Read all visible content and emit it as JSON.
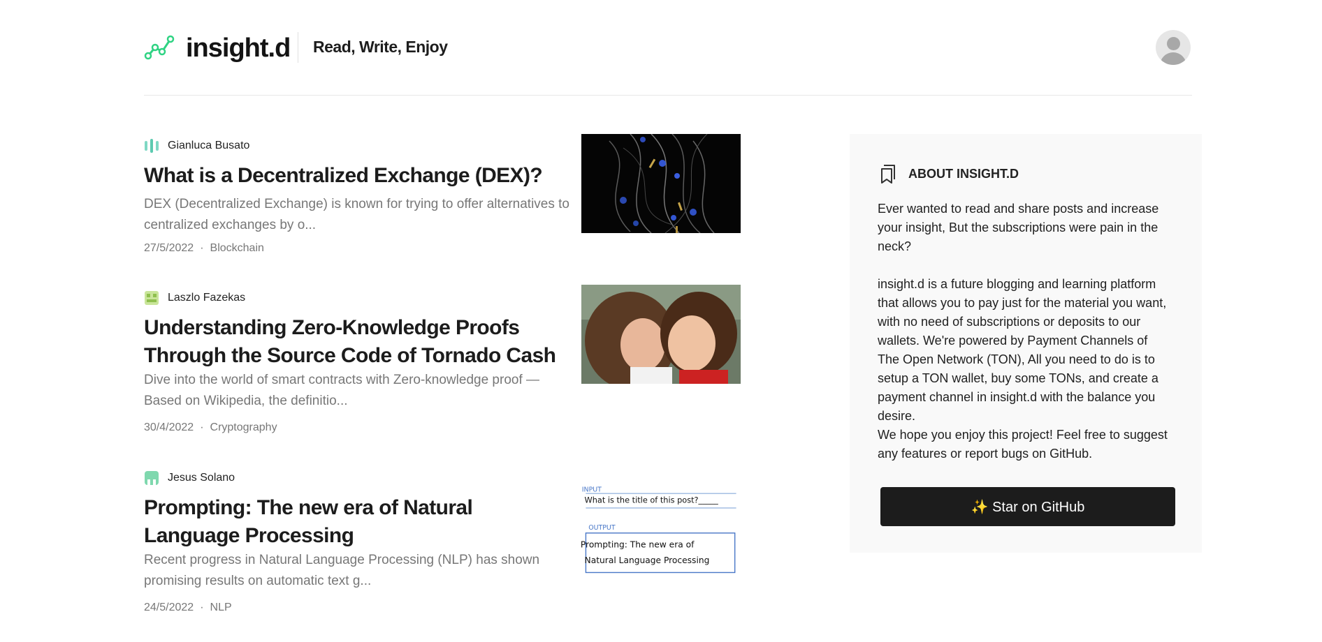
{
  "header": {
    "logo_text": "insight.d",
    "tagline": "Read, Write, Enjoy",
    "brand_color": "#2fd383"
  },
  "posts": [
    {
      "author": "Gianluca Busato",
      "title": "What is a Decentralized Exchange (DEX)?",
      "excerpt": "DEX (Decentralized Exchange) is known for trying to offer alternatives to centralized exchanges by o...",
      "date": "27/5/2022",
      "separator": "·",
      "category": "Blockchain"
    },
    {
      "author": "Laszlo Fazekas",
      "title": "Understanding Zero-Knowledge Proofs Through the Source Code of Tornado Cash",
      "excerpt": "Dive into the world of smart contracts with Zero-knowledge proof — Based on Wikipedia, the definitio...",
      "date": "30/4/2022",
      "separator": "·",
      "category": "Cryptography"
    },
    {
      "author": "Jesus Solano",
      "title": "Prompting: The new era of Natural Language Processing",
      "excerpt": "Recent progress in Natural Language Processing (NLP) has shown promising results on automatic text g...",
      "date": "24/5/2022",
      "separator": "·",
      "category": "NLP",
      "thumb_text": {
        "input_label": "INPUT",
        "input_line": "What is the title of this post?_____",
        "output_label": "OUTPUT",
        "output_line1": "Prompting: The new era of",
        "output_line2": "Natural Language Processing"
      }
    }
  ],
  "sidebar": {
    "title": "ABOUT INSIGHT.D",
    "para1": "Ever wanted to read and share posts and increase your insight, But the subscriptions were pain in the neck?",
    "para2": "insight.d is a future blogging and learning platform that allows you to pay just for the material you want, with no need of subscriptions or deposits to our wallets. We're powered by Payment Channels of The Open Network (TON), All you need to do is to setup a TON wallet, buy some TONs, and create a payment channel in insight.d with the balance you desire.",
    "para3": "We hope you enjoy this project! Feel free to suggest any features or report bugs on GitHub.",
    "button_label": "✨ Star on GitHub"
  }
}
